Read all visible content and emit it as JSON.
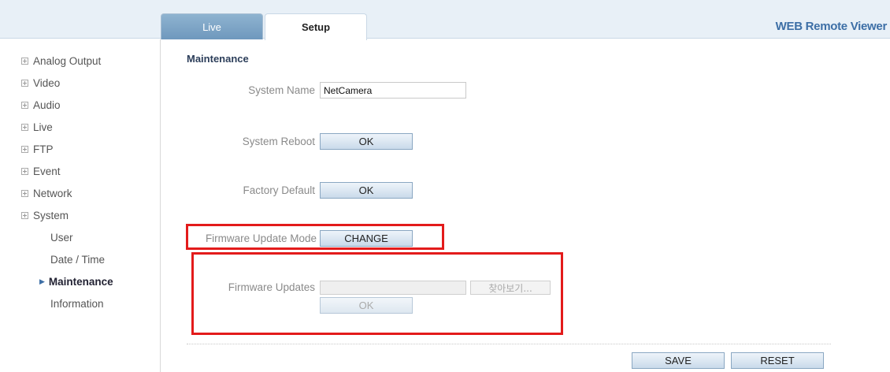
{
  "tabs": {
    "live": "Live",
    "setup": "Setup"
  },
  "brand": "WEB Remote Viewer",
  "sidebar": {
    "items": [
      "Analog Output",
      "Video",
      "Audio",
      "Live",
      "FTP",
      "Event",
      "Network",
      "System"
    ],
    "system_sub": [
      "User",
      "Date / Time",
      "Maintenance",
      "Information"
    ],
    "active": "Maintenance"
  },
  "main": {
    "title": "Maintenance",
    "system_name_label": "System Name",
    "system_name_value": "NetCamera",
    "system_reboot_label": "System Reboot",
    "system_reboot_button": "OK",
    "factory_default_label": "Factory Default",
    "factory_default_button": "OK",
    "firmware_mode_label": "Firmware Update Mode",
    "firmware_mode_button": "CHANGE",
    "firmware_updates_label": "Firmware Updates",
    "browse_button": "찾아보기...",
    "firmware_ok_button": "OK"
  },
  "footer": {
    "save": "SAVE",
    "reset": "RESET"
  },
  "colors": {
    "highlight": "#e31b1b",
    "accent": "#3d6fa6",
    "tab_live": "#6f98bd"
  }
}
